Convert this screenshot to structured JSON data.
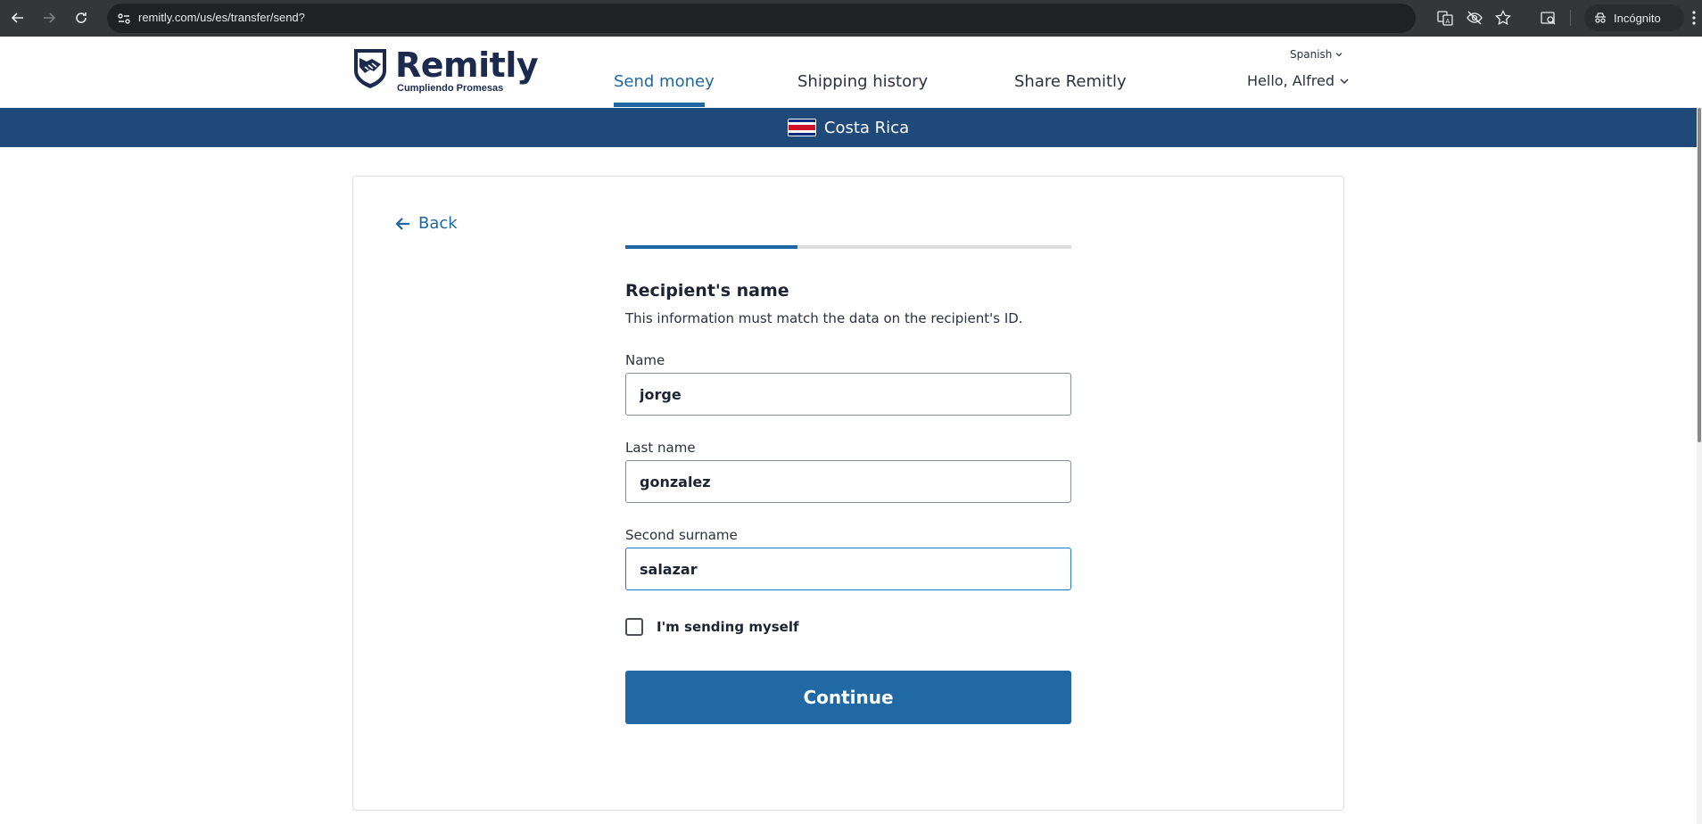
{
  "browser": {
    "url": "remitly.com/us/es/transfer/send?",
    "incognito_label": "Incógnito"
  },
  "header": {
    "logo_word": "Remitly",
    "logo_tagline": "Cumpliendo Promesas",
    "language": "Spanish",
    "greeting": "Hello, Alfred",
    "nav": [
      {
        "label": "Send money",
        "active": true
      },
      {
        "label": "Shipping history",
        "active": false
      },
      {
        "label": "Share Remitly",
        "active": false
      }
    ]
  },
  "country_bar": {
    "country": "Costa Rica",
    "flag_colors": [
      "#002b7f",
      "#ffffff",
      "#ce1126",
      "#ffffff",
      "#002b7f"
    ]
  },
  "form": {
    "back_label": "Back",
    "progress": 0.386,
    "title": "Recipient's name",
    "subtitle": "This information must match the data on the recipient's ID.",
    "fields": [
      {
        "label": "Name",
        "value": "jorge"
      },
      {
        "label": "Last name",
        "value": "gonzalez"
      },
      {
        "label": "Second surname",
        "value": "salazar"
      }
    ],
    "self_checkbox_label": "I'm sending myself",
    "self_checkbox_checked": false,
    "continue_label": "Continue"
  },
  "colors": {
    "brand_blue": "#1f66a5",
    "country_bar": "#1f4979",
    "button": "#2169a4",
    "logo_navy": "#1c2b4d"
  }
}
